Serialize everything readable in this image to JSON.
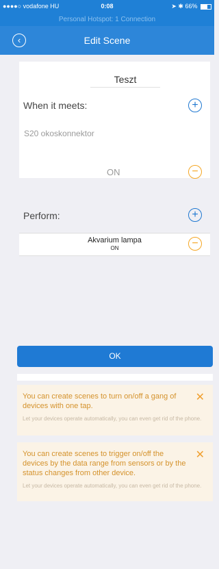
{
  "status": {
    "carrier": "●●●●○ vodafone HU",
    "time": "0:08",
    "battery": "66%"
  },
  "hotspot": "Personal Hotspot: 1 Connection",
  "nav": {
    "title": "Edit Scene"
  },
  "scene": {
    "name": "Teszt"
  },
  "condition": {
    "heading": "When it meets:",
    "device": "S20 okoskonnektor",
    "state": "ON"
  },
  "perform": {
    "heading": "Perform:",
    "device": "Akvarium lampa",
    "state": "ON"
  },
  "ok_label": "OK",
  "tips": [
    {
      "main": "You can create scenes to turn on/off a gang of devices with one tap.",
      "sub": "Let your devices operate automatically, you can even get rid of the phone."
    },
    {
      "main": "You can create scenes to trigger on/off the devices by the data range from sensors or by the status changes from other device.",
      "sub": "Let your devices operate automatically, you can even get rid of the phone."
    }
  ]
}
